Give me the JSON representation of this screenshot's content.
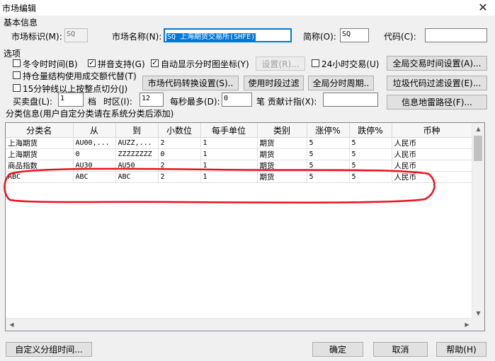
{
  "window": {
    "title": "市场编辑",
    "close_glyph": "✕"
  },
  "basic": {
    "section_label": "基本信息",
    "market_id_label": "市场标识(M):",
    "market_id_value": "SQ",
    "market_name_label": "市场名称(N):",
    "market_name_value": "SQ 上海期货交易所(SHFE)",
    "short_label": "简称(O):",
    "short_value": "SQ",
    "code_label": "代码(C):",
    "code_value": ""
  },
  "options": {
    "section_label": "选项",
    "winter_time": {
      "label": "冬令时时间(B)",
      "checked": false
    },
    "pinyin": {
      "label": "拼音支持(G)",
      "checked": true
    },
    "auto_minute": {
      "label": "自动显示分时图坐标(Y)",
      "checked": true
    },
    "settings_button": "设置(R)...",
    "trade_24h": {
      "label": "24小时交易(U)",
      "checked": false
    },
    "global_trade_time_button": "全局交易时间设置(A)...",
    "holding_turnover": {
      "label": "持仓量结构使用成交额代替(T)",
      "checked": false
    },
    "market_code_convert_button": "市场代码转换设置(S)..",
    "time_filter_button": "使用时段过滤",
    "global_minute_button": "全局分时周期..",
    "junk_code_filter_button": "垃圾代码过滤设置(E)...",
    "fifteen_min": {
      "label": "15分钟线以上按整点切分(J)",
      "checked": false
    },
    "bidask_label": "买卖盘(L):",
    "bidask_value": "1",
    "level_label": "档",
    "timezone_label": "时区(I):",
    "timezone_value": "12",
    "per_second_label": "每秒最多(D):",
    "per_second_value": "0",
    "contrib_label": "笔 贡献计指(X):",
    "contrib_value": "",
    "radar_path_button": "信息地雷路径(F)..."
  },
  "category": {
    "section_label": "分类信息(用户自定分类请在系统分类后添加)",
    "columns": [
      "分类名",
      "从",
      "到",
      "小数位",
      "每手单位",
      "类别",
      "涨停%",
      "跌停%",
      "币种"
    ],
    "rows": [
      [
        "上海期货",
        "AU00,...",
        "AUZZ,...",
        "2",
        "1",
        "期货",
        "5",
        "5",
        "人民币"
      ],
      [
        "上海期货",
        "0",
        "ZZZZZZZZ",
        "0",
        "1",
        "期货",
        "5",
        "5",
        "人民币"
      ],
      [
        "商品指数",
        "AU30",
        "AU50",
        "2",
        "1",
        "期货",
        "5",
        "5",
        "人民币"
      ],
      [
        "ABC",
        "ABC",
        "ABC",
        "2",
        "1",
        "期货",
        "5",
        "5",
        "人民币"
      ]
    ],
    "highlight_color": "#e8111e"
  },
  "footer": {
    "custom_group_time_button": "自定义分组时间...",
    "ok_button": "确定",
    "cancel_button": "取消",
    "help_button": "帮助(H)"
  }
}
